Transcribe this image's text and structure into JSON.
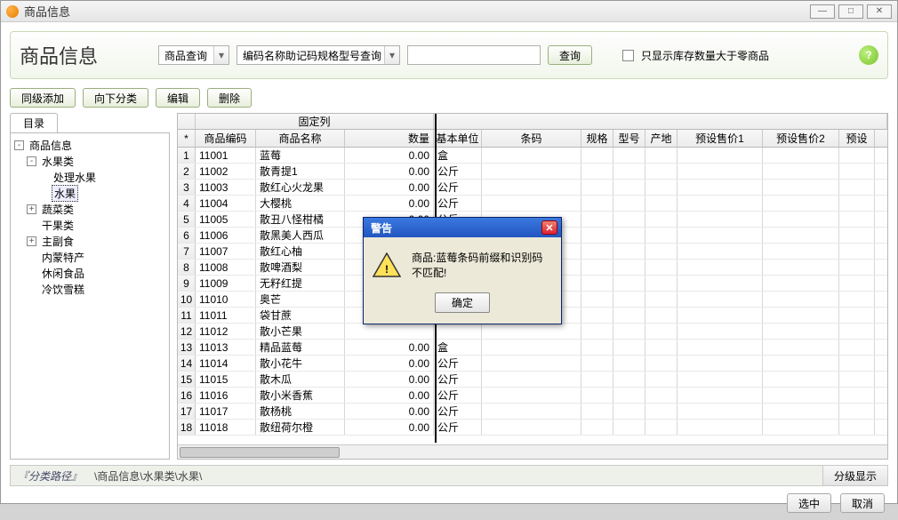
{
  "window": {
    "title": "商品信息"
  },
  "header": {
    "title": "商品信息",
    "search_mode": "商品查询",
    "search_field": "编码名称助记码规格型号查询",
    "search_value": "",
    "query_btn": "查询",
    "stock_checkbox_label": "只显示库存数量大于零商品"
  },
  "toolbar": {
    "add_sibling": "同级添加",
    "add_child": "向下分类",
    "edit": "编辑",
    "delete": "删除"
  },
  "tree": {
    "tab": "目录",
    "root": "商品信息",
    "nodes": [
      {
        "label": "水果类",
        "expanded": true,
        "children": [
          {
            "label": "处理水果"
          },
          {
            "label": "水果",
            "selected": true
          }
        ]
      },
      {
        "label": "蔬菜类",
        "expanded": false,
        "hasChildren": true
      },
      {
        "label": "干果类"
      },
      {
        "label": "主副食",
        "expanded": false,
        "hasChildren": true
      },
      {
        "label": "内蒙特产"
      },
      {
        "label": "休闲食品"
      },
      {
        "label": "冷饮雪糕"
      }
    ]
  },
  "grid": {
    "fixed_group": "固定列",
    "columns": [
      "*",
      "商品编码",
      "商品名称",
      "数量",
      "基本单位",
      "条码",
      "规格",
      "型号",
      "产地",
      "预设售价1",
      "预设售价2",
      "预设"
    ],
    "rows": [
      {
        "n": 1,
        "code": "11001",
        "name": "蓝莓",
        "qty": "0.00",
        "unit": "盒"
      },
      {
        "n": 2,
        "code": "11002",
        "name": "散青提1",
        "qty": "0.00",
        "unit": "公斤"
      },
      {
        "n": 3,
        "code": "11003",
        "name": "散红心火龙果",
        "qty": "0.00",
        "unit": "公斤"
      },
      {
        "n": 4,
        "code": "11004",
        "name": "大樱桃",
        "qty": "0.00",
        "unit": "公斤"
      },
      {
        "n": 5,
        "code": "11005",
        "name": "散丑八怪柑橘",
        "qty": "0.00",
        "unit": "公斤"
      },
      {
        "n": 6,
        "code": "11006",
        "name": "散黑美人西瓜",
        "qty": "",
        "unit": ""
      },
      {
        "n": 7,
        "code": "11007",
        "name": "散红心柚",
        "qty": "",
        "unit": ""
      },
      {
        "n": 8,
        "code": "11008",
        "name": "散啤酒梨",
        "qty": "",
        "unit": ""
      },
      {
        "n": 9,
        "code": "11009",
        "name": "无籽红提",
        "qty": "",
        "unit": ""
      },
      {
        "n": 10,
        "code": "11010",
        "name": "奥芒",
        "qty": "",
        "unit": ""
      },
      {
        "n": 11,
        "code": "11011",
        "name": "袋甘蔗",
        "qty": "",
        "unit": ""
      },
      {
        "n": 12,
        "code": "11012",
        "name": "散小芒果",
        "qty": "",
        "unit": ""
      },
      {
        "n": 13,
        "code": "11013",
        "name": "精品蓝莓",
        "qty": "0.00",
        "unit": "盒"
      },
      {
        "n": 14,
        "code": "11014",
        "name": "散小花牛",
        "qty": "0.00",
        "unit": "公斤"
      },
      {
        "n": 15,
        "code": "11015",
        "name": "散木瓜",
        "qty": "0.00",
        "unit": "公斤"
      },
      {
        "n": 16,
        "code": "11016",
        "name": "散小米香蕉",
        "qty": "0.00",
        "unit": "公斤"
      },
      {
        "n": 17,
        "code": "11017",
        "name": "散杨桃",
        "qty": "0.00",
        "unit": "公斤"
      },
      {
        "n": 18,
        "code": "11018",
        "name": "散纽荷尔橙",
        "qty": "0.00",
        "unit": "公斤"
      }
    ]
  },
  "status": {
    "label": "『分类路径』",
    "path": "\\商品信息\\水果类\\水果\\",
    "level_btn": "分级显示"
  },
  "footer": {
    "ok": "选中",
    "cancel": "取消"
  },
  "modal": {
    "title": "警告",
    "message": "商品:蓝莓条码前缀和识别码不匹配!",
    "ok": "确定"
  }
}
